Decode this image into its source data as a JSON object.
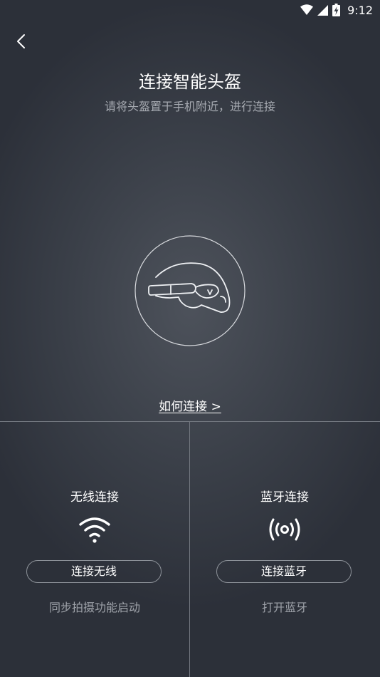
{
  "status_bar": {
    "time": "9:12",
    "icons": [
      "wifi-icon",
      "cell-signal-icon",
      "battery-charging-icon"
    ]
  },
  "header": {
    "back_icon": "chevron-left-icon",
    "title": "连接智能头盔",
    "subtitle": "请将头盔置于手机附近，进行连接"
  },
  "illustration": {
    "icon": "helmet-icon"
  },
  "help_link": "如何连接 >",
  "panels": [
    {
      "title": "无线连接",
      "icon": "wifi-icon",
      "button": "连接无线",
      "status": "同步拍摄功能启动"
    },
    {
      "title": "蓝牙连接",
      "icon": "broadcast-icon",
      "button": "连接蓝牙",
      "status": "打开蓝牙"
    }
  ],
  "colors": {
    "background": "#3a3f48",
    "divider": "#737880",
    "secondary_text": "#a7abb2"
  }
}
